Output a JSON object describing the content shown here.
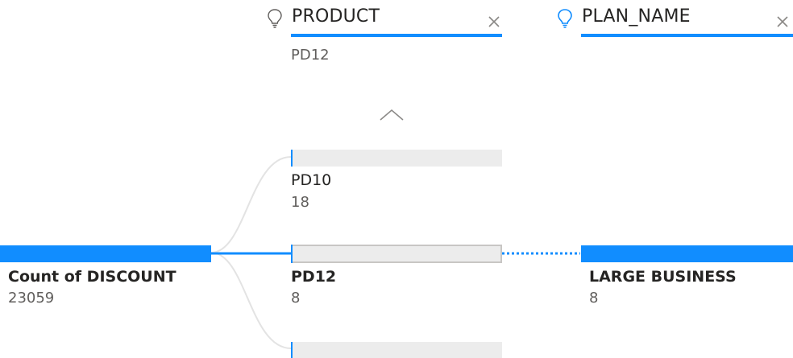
{
  "levels": [
    {
      "title": "PRODUCT",
      "selected": "PD12",
      "icon": "lightbulb-icon"
    },
    {
      "title": "PLAN_NAME",
      "icon": "lightbulb-icon"
    }
  ],
  "root": {
    "label": "Count of DISCOUNT",
    "value": "23059"
  },
  "product_nodes": [
    {
      "label": "PD10",
      "value": "18"
    },
    {
      "label": "PD12",
      "value": "8"
    }
  ],
  "plan_nodes": [
    {
      "label": "LARGE BUSINESS",
      "value": "8"
    }
  ],
  "colors": {
    "accent": "#118DFF",
    "bar_empty": "#ECECEC",
    "text": "#252423",
    "muted": "#605E5C"
  }
}
